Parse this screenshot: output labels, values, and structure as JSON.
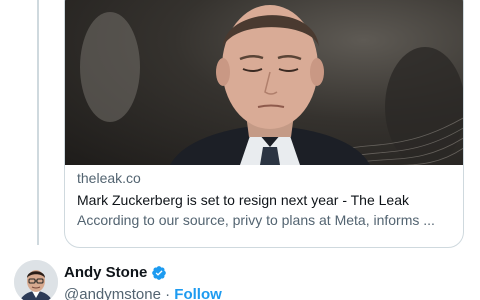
{
  "card": {
    "domain": "theleak.co",
    "title": "Mark Zuckerberg is set to resign next year - The Leak",
    "description": "According to our source, privy to plans at Meta, informs ..."
  },
  "author": {
    "name": "Andy Stone",
    "handle": "@andymstone",
    "separator": "·",
    "follow_label": "Follow",
    "verified": true
  },
  "colors": {
    "accent": "#1d9bf0",
    "text_primary": "#0f1419",
    "text_secondary": "#536471",
    "border": "#cfd9de"
  },
  "icons": {
    "verified": "verified-badge-icon"
  }
}
